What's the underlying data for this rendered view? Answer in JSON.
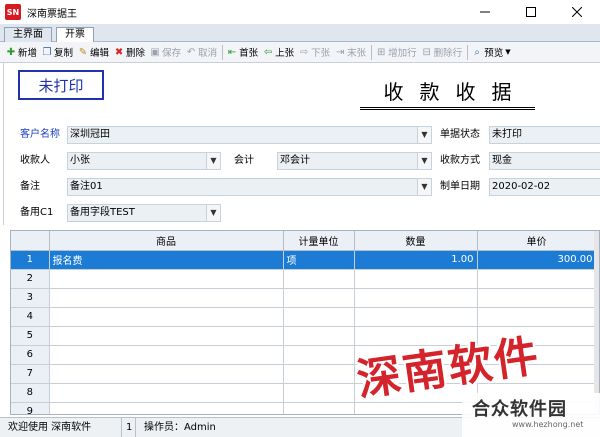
{
  "window": {
    "icon_text": "SN",
    "title": "深南票据王"
  },
  "tabs": [
    {
      "label": "主界面"
    },
    {
      "label": "开票"
    }
  ],
  "toolbar": {
    "new": "新增",
    "copy": "复制",
    "edit": "编辑",
    "delete": "删除",
    "save": "保存",
    "cancel": "取消",
    "first": "首张",
    "prev": "上张",
    "next": "下张",
    "last": "末张",
    "add_row": "增加行",
    "del_row": "删除行",
    "preview": "预览"
  },
  "form": {
    "status_box": "未打印",
    "doc_title": "收款收据",
    "customer_label": "客户名称",
    "customer_value": "深圳冠田",
    "doc_status_label": "单据状态",
    "doc_status_value": "未打印",
    "payee_label": "收款人",
    "payee_value": "小张",
    "accountant_label": "会计",
    "accountant_value": "邓会计",
    "pay_method_label": "收款方式",
    "pay_method_value": "现金",
    "remark_label": "备注",
    "remark_value": "备注01",
    "date_label": "制单日期",
    "date_value": "2020-02-02",
    "spare_label": "备用C1",
    "spare_value": "备用字段TEST"
  },
  "grid": {
    "headers": [
      "",
      "商品",
      "计量单位",
      "数量",
      "单价"
    ],
    "rows": [
      {
        "n": "1",
        "item": "报名费",
        "unit": "项",
        "qty": "1.00",
        "price": "300.00"
      },
      {
        "n": "2"
      },
      {
        "n": "3"
      },
      {
        "n": "4"
      },
      {
        "n": "5"
      },
      {
        "n": "6"
      },
      {
        "n": "7"
      },
      {
        "n": "8"
      },
      {
        "n": "9"
      }
    ]
  },
  "statusbar": {
    "welcome": "欢迎使用 深南软件",
    "num": "1",
    "operator": "操作员：Admin"
  },
  "watermark": {
    "brand": "深南软件",
    "site_name": "合众软件园",
    "site_url": "www.hezhong.net"
  },
  "colors": {
    "accent": "#1c7cd5",
    "brand_red": "#d4232b",
    "label_blue": "#1a40c8"
  }
}
